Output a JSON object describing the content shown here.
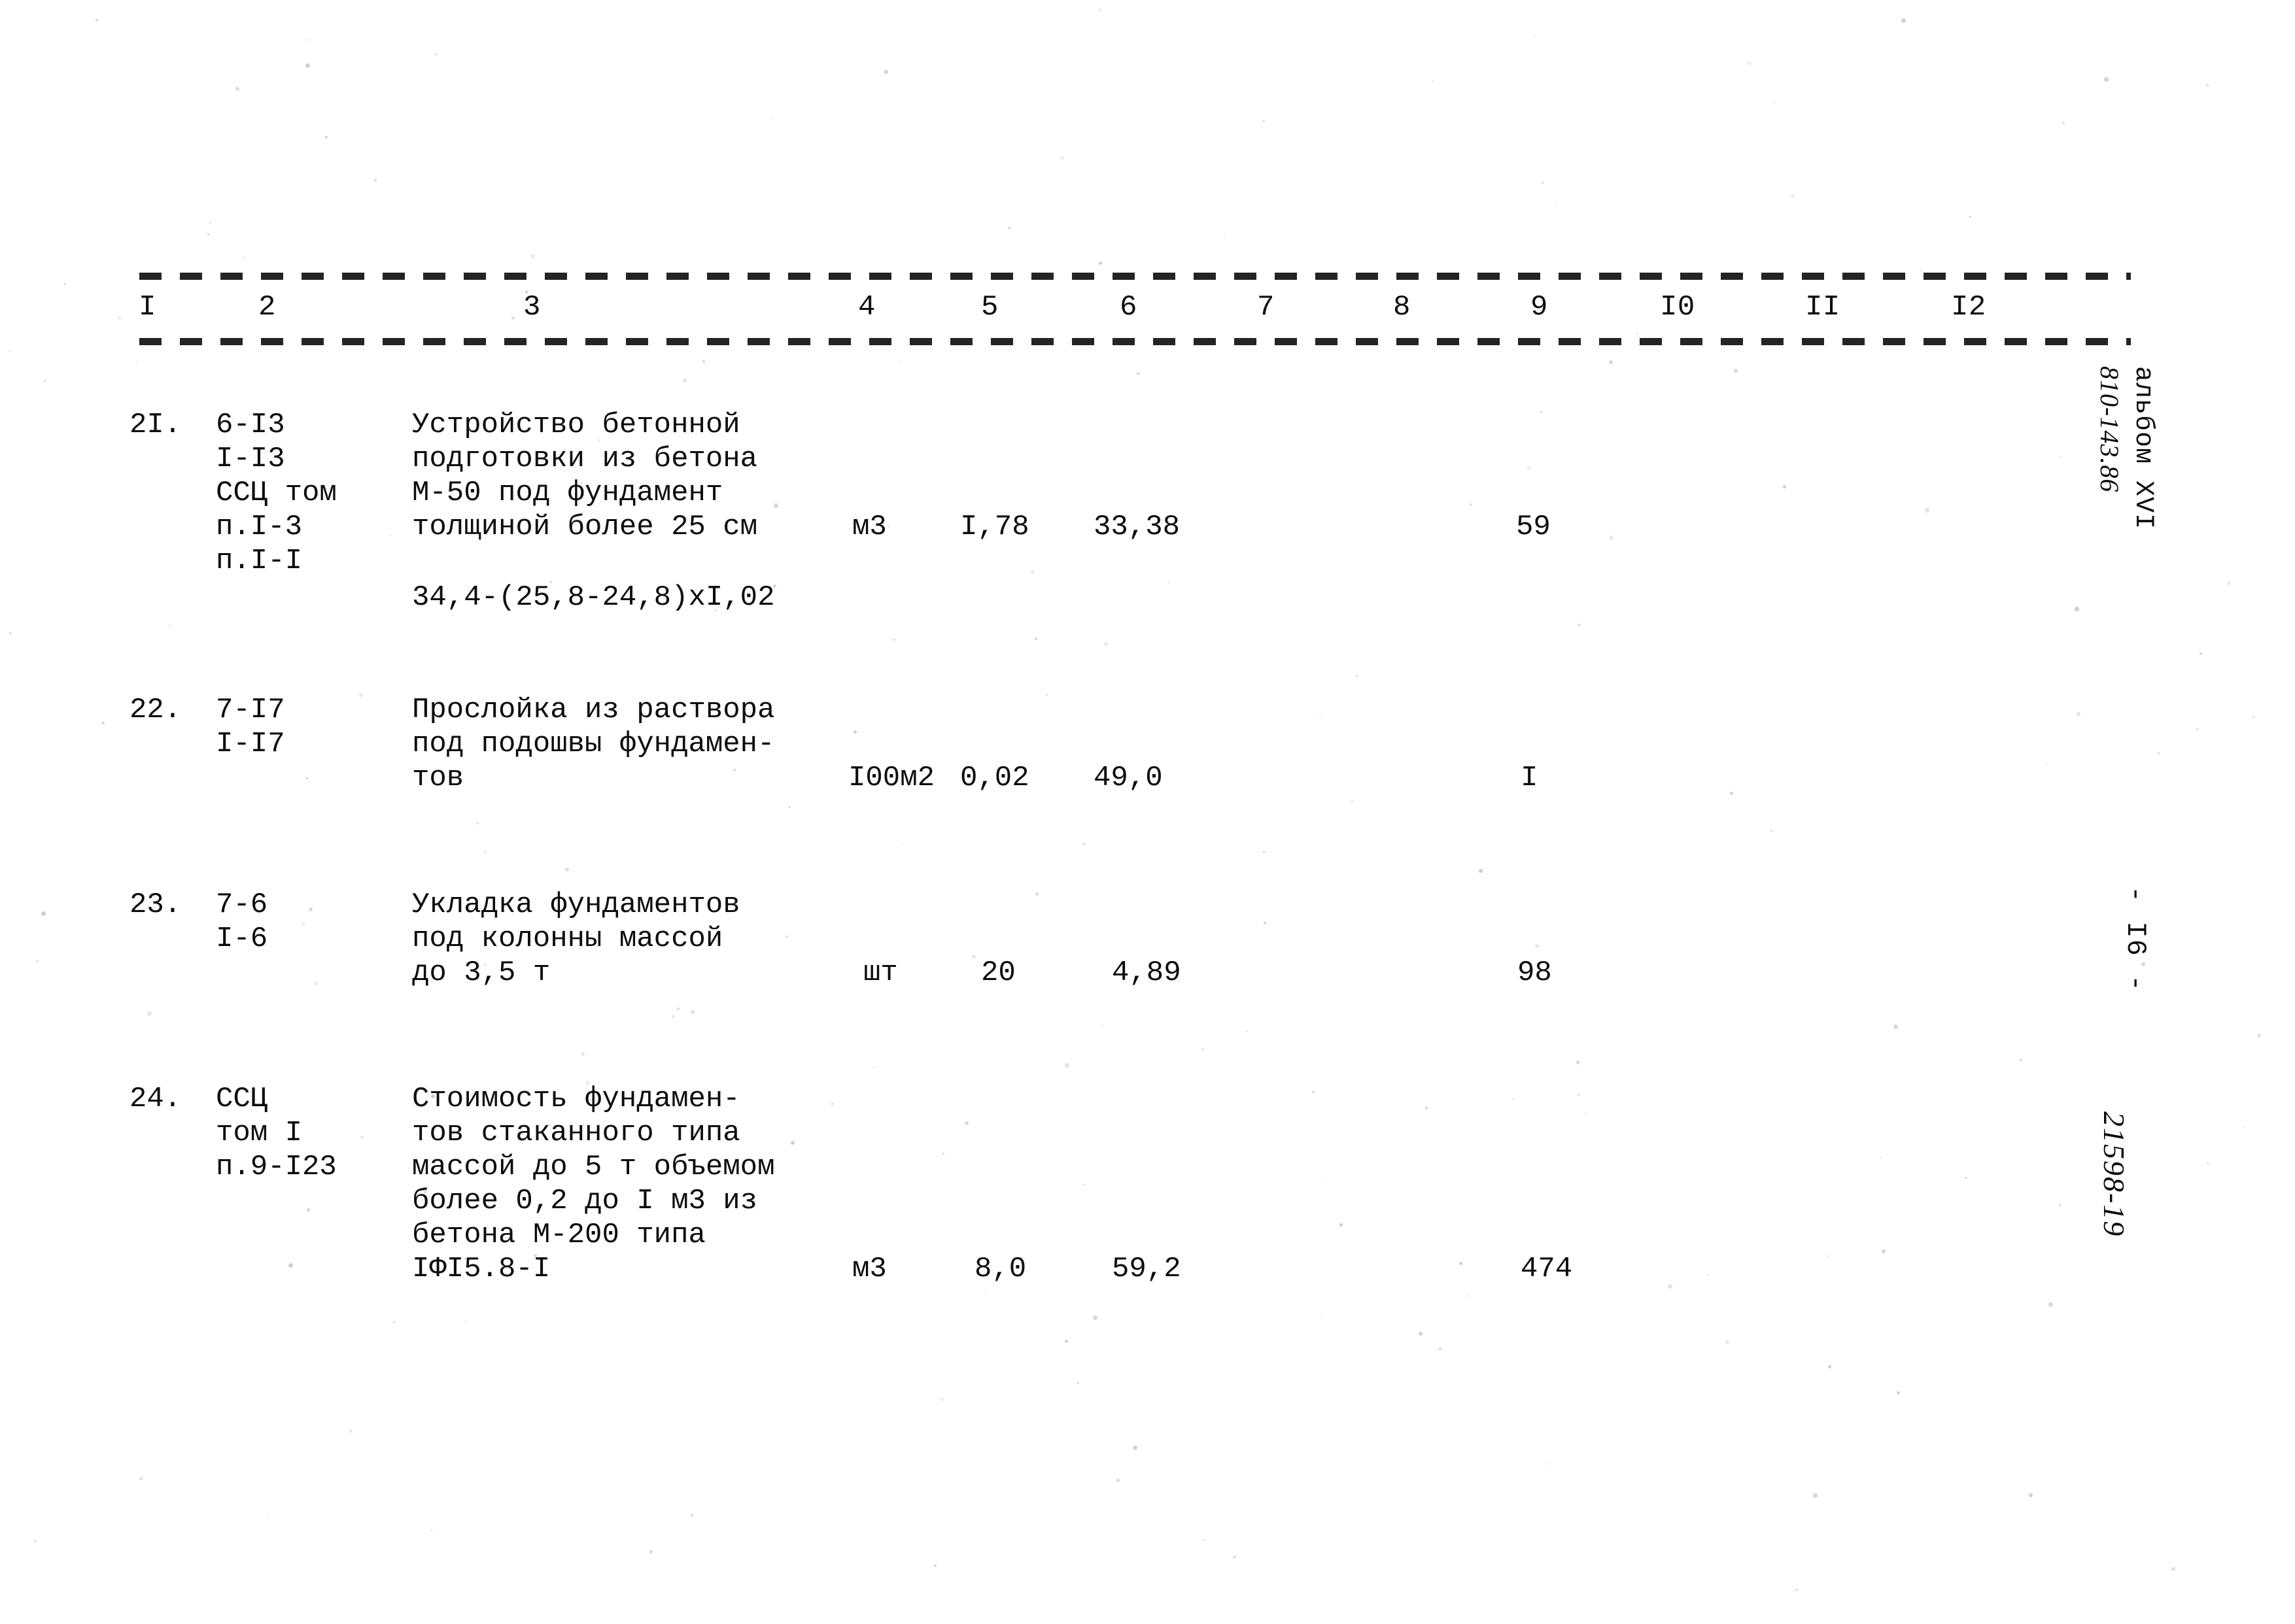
{
  "document": {
    "kind": "scanned-estimate-table",
    "header": {
      "columns": [
        "I",
        "2",
        "3",
        "4",
        "5",
        "6",
        "7",
        "8",
        "9",
        "I0",
        "II",
        "I2"
      ]
    },
    "rows": [
      {
        "no": "2I.",
        "code_lines": [
          "6-I3",
          "I-I3",
          "ССЦ том",
          "п.I-3",
          "п.I-I"
        ],
        "desc_lines": [
          "Устройство бетонной",
          "подготовки из бетона",
          "М-50 под фундамент",
          "толщиной более 25 см"
        ],
        "desc_formula": "34,4-(25,8-24,8)xI,02",
        "unit": "м3",
        "qty": "I,78",
        "price": "33,38",
        "col9": "59"
      },
      {
        "no": "22.",
        "code_lines": [
          "7-I7",
          "I-I7"
        ],
        "desc_lines": [
          "Прослойка из раствора",
          "под подошвы фундамен-",
          "тов"
        ],
        "desc_formula": "",
        "unit": "I00м2",
        "qty": "0,02",
        "price": "49,0",
        "col9": "I"
      },
      {
        "no": "23.",
        "code_lines": [
          "7-6",
          "I-6"
        ],
        "desc_lines": [
          "Укладка фундаментов",
          "под колонны массой",
          "до 3,5 т"
        ],
        "desc_formula": "",
        "unit": "шт",
        "qty": "20",
        "price": "4,89",
        "col9": "98"
      },
      {
        "no": "24.",
        "code_lines": [
          "ССЦ",
          "том I",
          "п.9-I23"
        ],
        "desc_lines": [
          "Стоимость фундамен-",
          "тов стаканного типа",
          "массой до 5 т объемом",
          "более 0,2 до I м3 из",
          "бетона М-200 типа",
          "IФI5.8-I"
        ],
        "desc_formula": "",
        "unit": "м3",
        "qty": "8,0",
        "price": "59,2",
        "col9": "474"
      }
    ],
    "margin": {
      "album_label": "альбом XVI",
      "album_code": "810-143.86",
      "page_number": "- I6 -",
      "doc_number": "21598-19"
    }
  }
}
